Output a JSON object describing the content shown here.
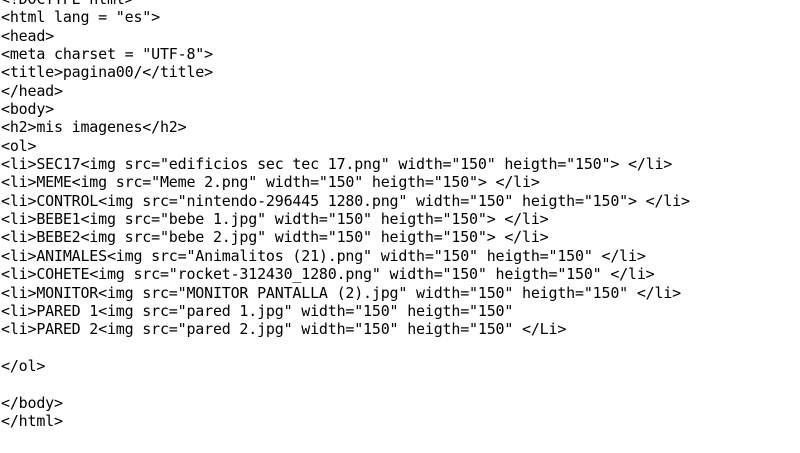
{
  "editor": {
    "lines": [
      "<!DOCTYPE html>",
      "<html lang = \"es\">",
      "<head>",
      "<meta charset = \"UTF-8\">",
      "<title>pagina00/</title>",
      "</head>",
      "<body>",
      "<h2>mis imagenes</h2>",
      "<ol>",
      "<li>SEC17<img src=\"edificios sec tec 17.png\" width=\"150\" heigth=\"150\"> </li>",
      "<li>MEME<img src=\"Meme 2.png\" width=\"150\" heigth=\"150\"> </li>",
      "<li>CONTROL<img src=\"nintendo-296445 1280.png\" width=\"150\" heigth=\"150\"> </li>",
      "<li>BEBE1<img src=\"bebe 1.jpg\" width=\"150\" heigth=\"150\"> </li>",
      "<li>BEBE2<img src=\"bebe 2.jpg\" width=\"150\" heigth=\"150\"> </li>",
      "<li>ANIMALES<img src=\"Animalitos (21).png\" width=\"150\" heigth=\"150\" </li>",
      "<li>COHETE<img src=\"rocket-312430_1280.png\" width=\"150\" heigth=\"150\" </li>",
      "<li>MONITOR<img src=\"MONITOR PANTALLA (2).jpg\" width=\"150\" heigth=\"150\" </li>",
      "<li>PARED 1<img src=\"pared 1.jpg\" width=\"150\" heigth=\"150\"",
      "<li>PARED 2<img src=\"pared 2.jpg\" width=\"150\" heigth=\"150\" </Li>",
      "",
      "</ol>",
      "",
      "</body>",
      "</html>"
    ]
  }
}
